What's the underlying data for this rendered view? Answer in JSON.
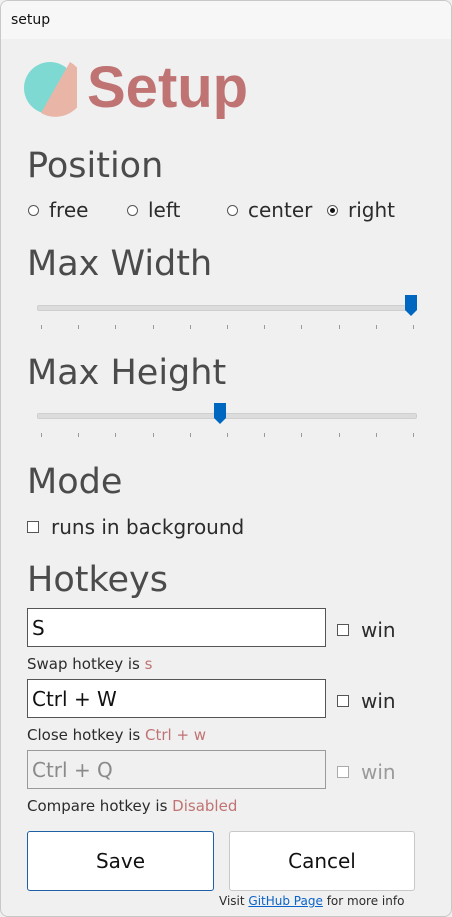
{
  "window": {
    "title": "setup"
  },
  "header": {
    "title": "Setup"
  },
  "position": {
    "heading": "Position",
    "options": [
      {
        "label": "free",
        "selected": false
      },
      {
        "label": "left",
        "selected": false
      },
      {
        "label": "center",
        "selected": false
      },
      {
        "label": "right",
        "selected": true
      }
    ]
  },
  "max_width": {
    "heading": "Max Width",
    "value_fraction": 1.0,
    "ticks": 11
  },
  "max_height": {
    "heading": "Max Height",
    "value_fraction": 0.48,
    "ticks": 11
  },
  "mode": {
    "heading": "Mode",
    "run_in_background_label": "runs in background",
    "run_in_background_checked": false
  },
  "hotkeys": {
    "heading": "Hotkeys",
    "items": [
      {
        "value": "S",
        "win_label": "win",
        "win_checked": false,
        "note_prefix": "Swap hotkey is",
        "note_value": "s",
        "disabled": false
      },
      {
        "value": "Ctrl + W",
        "win_label": "win",
        "win_checked": false,
        "note_prefix": "Close hotkey is",
        "note_value": "Ctrl + w",
        "disabled": false
      },
      {
        "value": "Ctrl + Q",
        "win_label": "win",
        "win_checked": false,
        "note_prefix": "Compare hotkey is",
        "note_value": "Disabled",
        "disabled": true
      }
    ]
  },
  "buttons": {
    "save": "Save",
    "cancel": "Cancel"
  },
  "footer": {
    "prefix": "Visit",
    "link": "GitHub Page",
    "suffix": "for more info"
  },
  "colors": {
    "accent": "#c07373",
    "slider_thumb": "#0067c0",
    "link": "#0a63c9",
    "logo_teal": "#7fd9d3",
    "logo_peach": "#e9b5a6"
  }
}
